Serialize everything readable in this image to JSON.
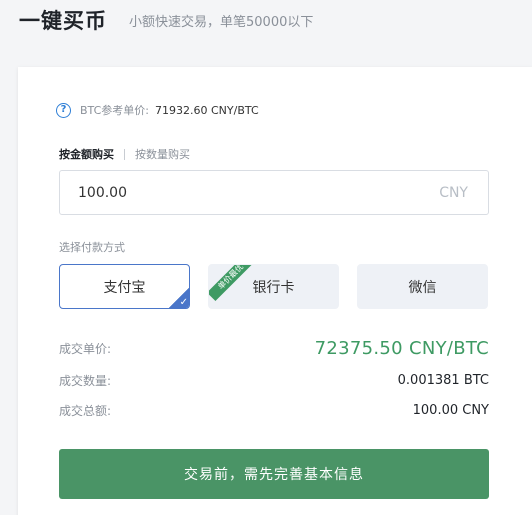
{
  "header": {
    "title": "一键买币",
    "subtitle": "小额快速交易，单笔50000以下"
  },
  "reference": {
    "label": "BTC参考单价:",
    "value": "71932.60 CNY/BTC"
  },
  "mode_tabs": [
    {
      "label": "按金额购买",
      "active": true
    },
    {
      "label": "按数量购买",
      "active": false
    }
  ],
  "amount": {
    "value": "100.00",
    "unit": "CNY"
  },
  "payment": {
    "label": "选择付款方式",
    "options": [
      {
        "label": "支付宝",
        "selected": true
      },
      {
        "label": "银行卡",
        "selected": false,
        "badge": "单价最优"
      },
      {
        "label": "微信",
        "selected": false
      }
    ]
  },
  "summary": {
    "price_label": "成交单价:",
    "price_value": "72375.50 CNY/BTC",
    "qty_label": "成交数量:",
    "qty_value": "0.001381 BTC",
    "total_label": "成交总额:",
    "total_value": "100.00 CNY"
  },
  "submit_label": "交易前，需先完善基本信息",
  "colors": {
    "accent_green": "#4a9466",
    "price_green": "#3e9a63",
    "selected_blue": "#4a76c9",
    "help_blue": "#2f7fd6"
  }
}
